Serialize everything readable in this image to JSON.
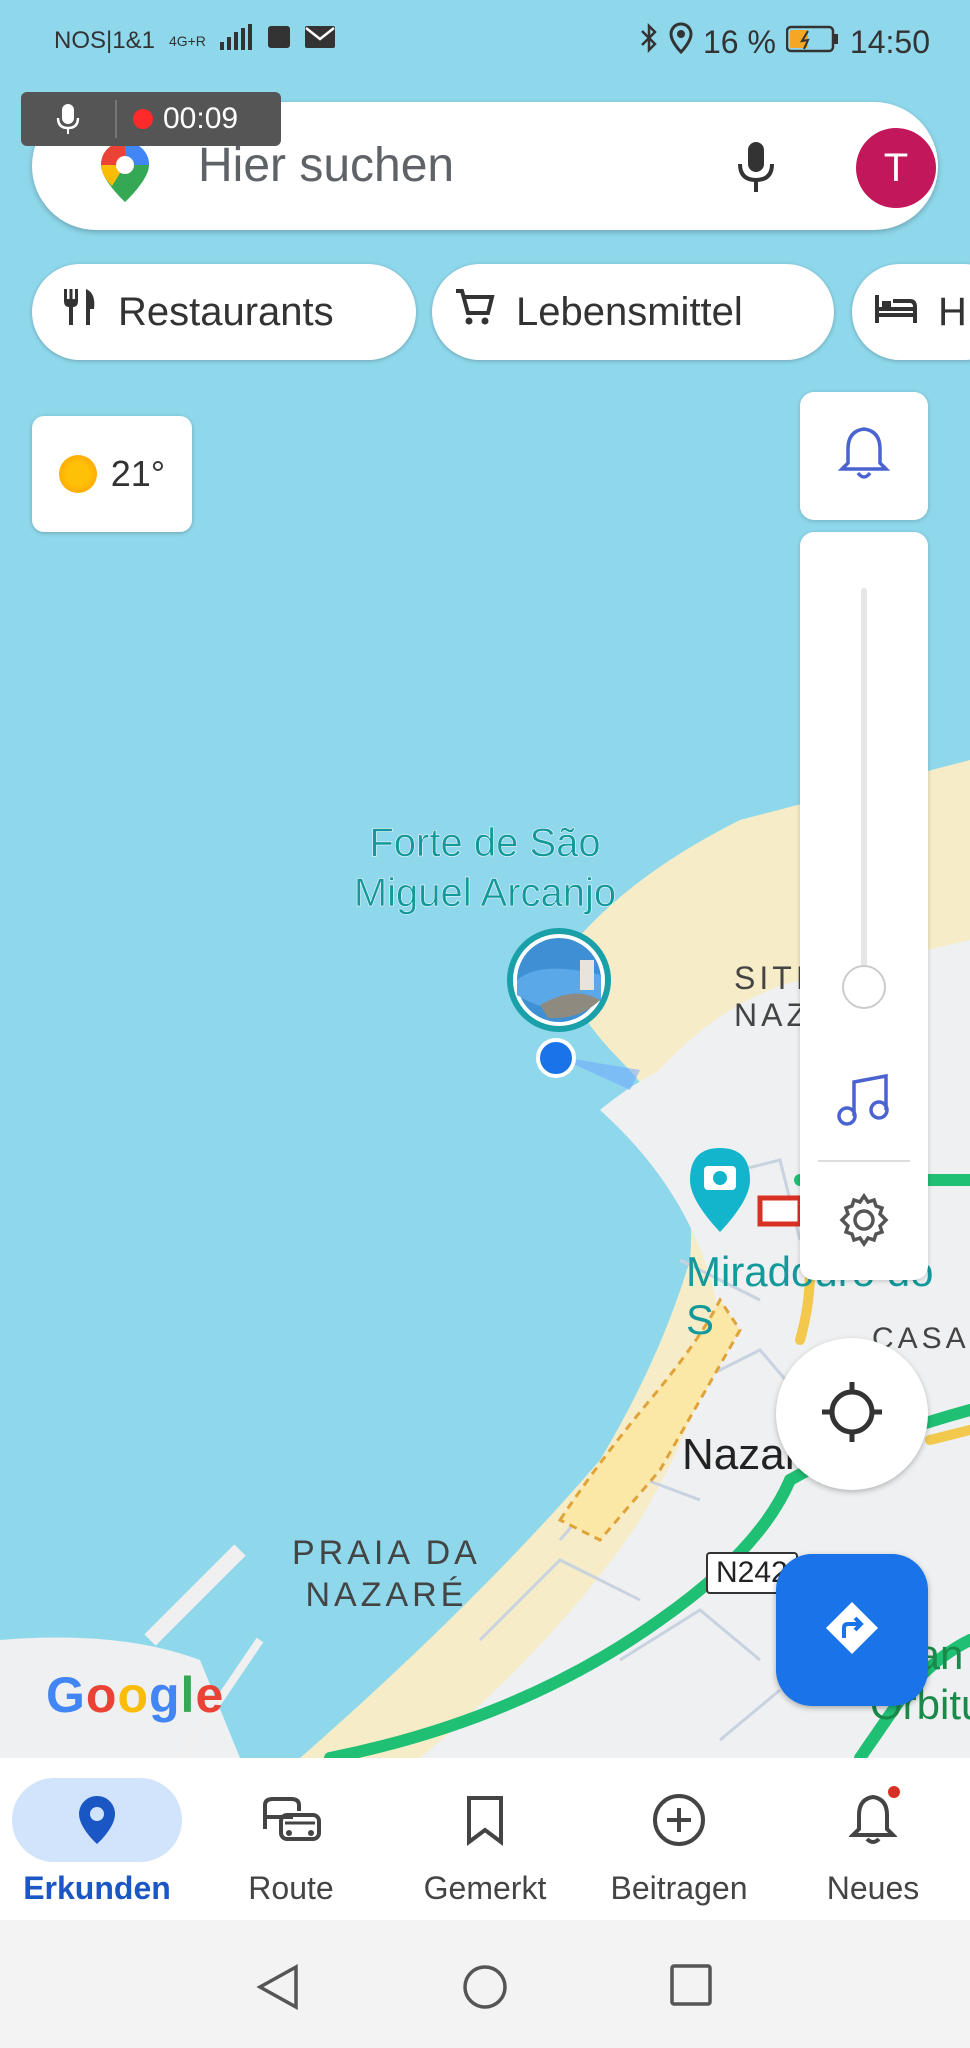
{
  "statusbar": {
    "carrier": "NOS|1&1",
    "network": "4G+R",
    "battery_percent": "16 %",
    "time": "14:50"
  },
  "recording": {
    "elapsed": "00:09"
  },
  "search": {
    "placeholder": "Hier suchen",
    "avatar_letter": "T"
  },
  "chips": [
    {
      "label": "Restaurants",
      "icon": "restaurant-icon"
    },
    {
      "label": "Lebensmittel",
      "icon": "cart-icon"
    },
    {
      "label": "H",
      "icon": "bed-icon"
    }
  ],
  "weather": {
    "temperature": "21°",
    "icon": "sun-icon"
  },
  "map": {
    "poi_forte_line1": "Forte de São",
    "poi_forte_line2": "Miguel Arcanjo",
    "sitio": "SITIO DA NAZ",
    "miradouro": "Miradouro do S",
    "casa": "CASA",
    "nazare": "Nazaré",
    "praia_line1": "PRAIA DA",
    "praia_line2": "NAZARÉ",
    "road_shield": "N242",
    "green_line1": "Gran",
    "green_line2": "Orbitur",
    "google": "Google",
    "colors": {
      "water": "#8fd8ec",
      "land": "#eef0f1",
      "beach": "#f6ecc7",
      "road_green": "#1fbf74",
      "accent": "#1a73e8"
    }
  },
  "volume": {
    "level_fraction": 0.05,
    "icons": [
      "bell-icon",
      "music-note-icon",
      "gear-icon"
    ]
  },
  "bottomnav": {
    "items": [
      {
        "label": "Erkunden",
        "icon": "location-pin-icon",
        "active": true
      },
      {
        "label": "Route",
        "icon": "commute-icon",
        "active": false
      },
      {
        "label": "Gemerkt",
        "icon": "bookmark-icon",
        "active": false
      },
      {
        "label": "Beitragen",
        "icon": "add-circle-icon",
        "active": false
      },
      {
        "label": "Neues",
        "icon": "notification-bell-icon",
        "active": false
      }
    ]
  }
}
